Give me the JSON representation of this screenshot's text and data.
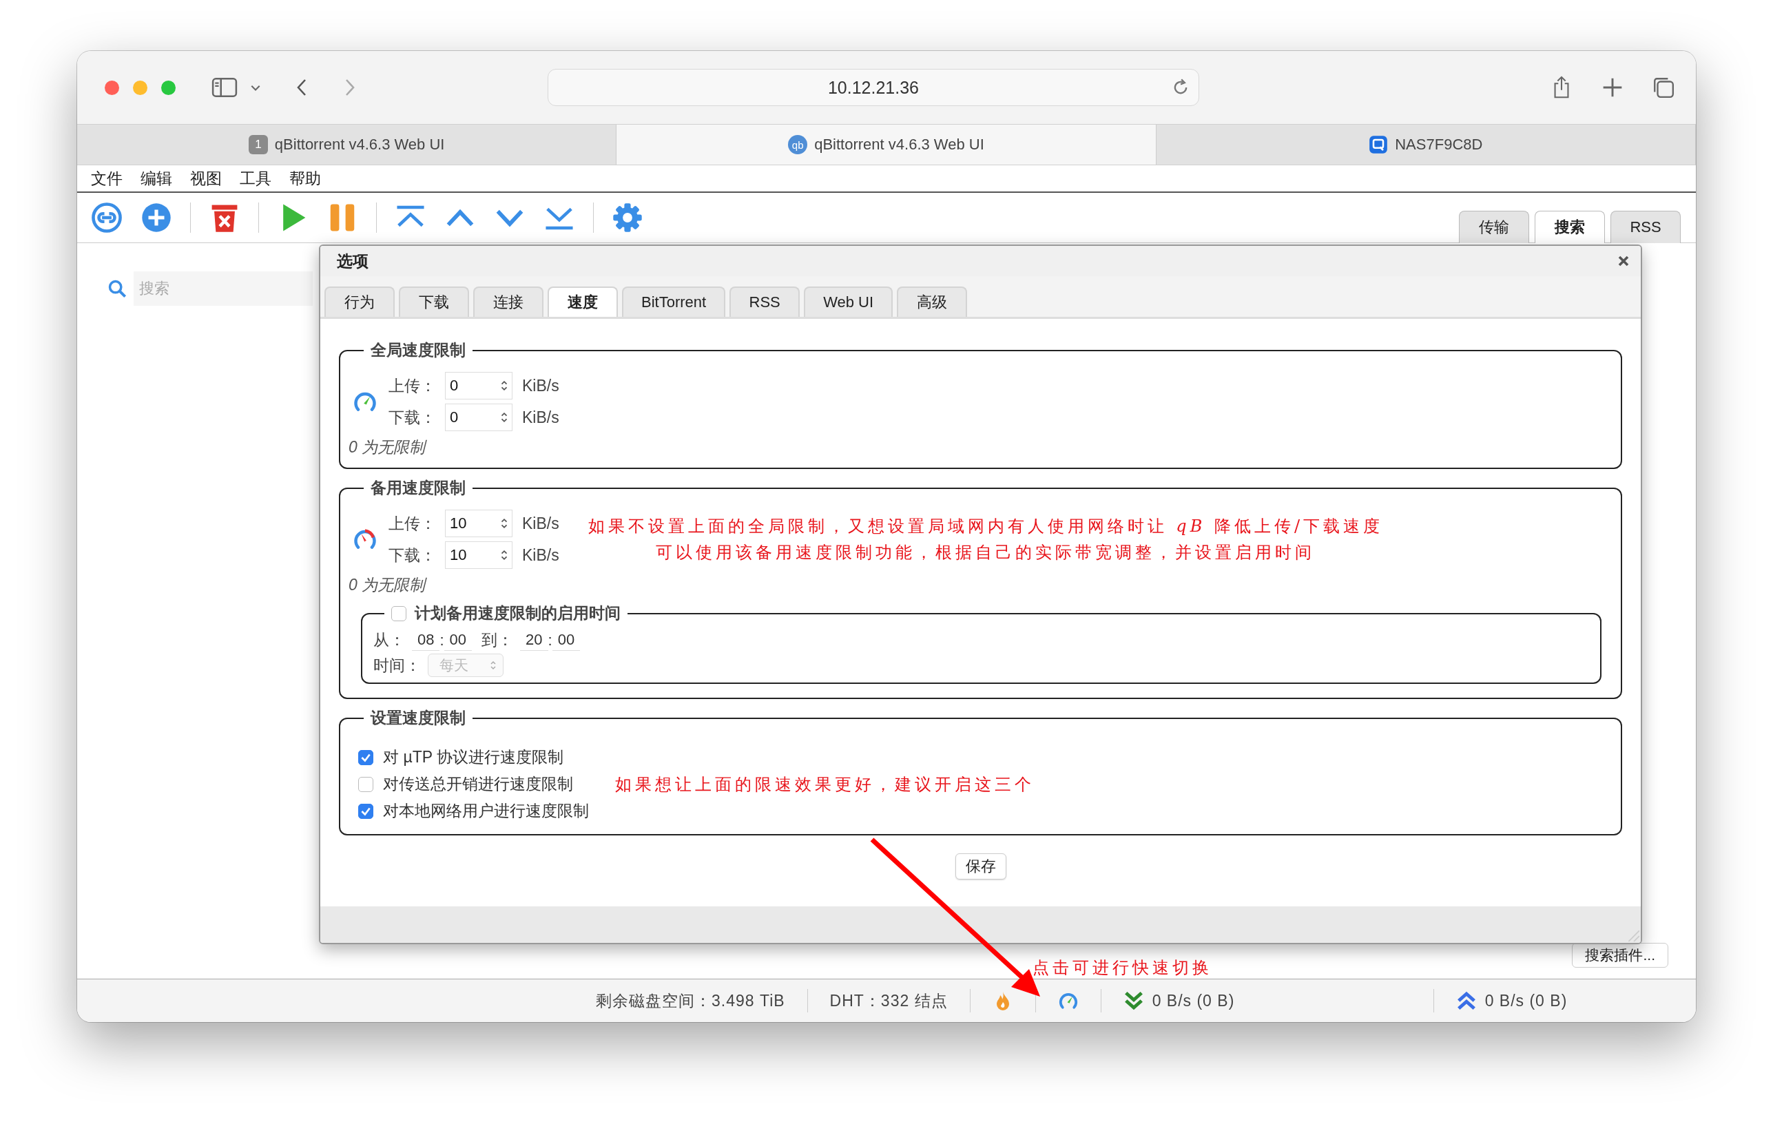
{
  "browser": {
    "url": "10.12.21.36",
    "tabs": [
      {
        "label": "qBittorrent v4.6.3 Web UI",
        "kind": "number",
        "badge": "1",
        "selected": false
      },
      {
        "label": "qBittorrent v4.6.3 Web UI",
        "kind": "letters",
        "badge": "qb",
        "selected": true
      },
      {
        "label": "NAS7F9C8D",
        "kind": "nas",
        "selected": false
      }
    ]
  },
  "menu": [
    "文件",
    "编辑",
    "视图",
    "工具",
    "帮助"
  ],
  "panel_tabs": [
    {
      "label": "传输",
      "selected": false
    },
    {
      "label": "搜索",
      "selected": true
    },
    {
      "label": "RSS",
      "selected": false
    }
  ],
  "search": {
    "placeholder": "搜索"
  },
  "dialog": {
    "title": "选项",
    "tabs": [
      {
        "label": "行为",
        "selected": false
      },
      {
        "label": "下载",
        "selected": false
      },
      {
        "label": "连接",
        "selected": false
      },
      {
        "label": "速度",
        "selected": true
      },
      {
        "label": "BitTorrent",
        "selected": false
      },
      {
        "label": "RSS",
        "selected": false
      },
      {
        "label": "Web UI",
        "selected": false
      },
      {
        "label": "高级",
        "selected": false
      }
    ],
    "global_limit": {
      "legend": "全局速度限制",
      "kind": "normal",
      "rows": [
        {
          "label": "上传：",
          "value": "0",
          "unit": "KiB/s"
        },
        {
          "label": "下载：",
          "value": "0",
          "unit": "KiB/s"
        }
      ],
      "note": "0 为无限制"
    },
    "alt_limit": {
      "legend": "备用速度限制",
      "kind": "alternative",
      "rows": [
        {
          "label": "上传：",
          "value": "10",
          "unit": "KiB/s"
        },
        {
          "label": "下载：",
          "value": "10",
          "unit": "KiB/s"
        }
      ],
      "note": "0 为无限制",
      "annotation": [
        "如果不设置上面的全局限制，又想设置局域网内有人使用网络时让 *qB* 降低上传/下载速度",
        "可以使用该备用速度限制功能，根据自己的实际带宽调整，并设置启用时间"
      ]
    },
    "schedule": {
      "label": "计划备用速度限制的启用时间",
      "checked": false,
      "from_label": "从：",
      "from": {
        "hour": "08",
        "sep": ":",
        "minute": "00"
      },
      "to_label": "到：",
      "to": {
        "hour": "20",
        "sep": ":",
        "minute": "00"
      },
      "days_label": "时间：",
      "days_value": "每天",
      "days_disabled": true
    },
    "settings": {
      "legend": "设置速度限制",
      "options": [
        {
          "label": "对 µTP 协议进行速度限制",
          "checked": true
        },
        {
          "label": "对传送总开销进行速度限制",
          "checked": false
        },
        {
          "label": "对本地网络用户进行速度限制",
          "checked": true
        }
      ],
      "annotation": "如果想让上面的限速效果更好，建议开启这三个"
    },
    "save": "保存"
  },
  "search_plugins": "搜索插件...",
  "arrow_annotation": "点击可进行快速切换",
  "status_bar": {
    "free_space": "剩余磁盘空间：3.498 TiB",
    "dht": "DHT：332 结点",
    "download": "0 B/s (0 B)",
    "upload": "0 B/s (0 B)"
  }
}
